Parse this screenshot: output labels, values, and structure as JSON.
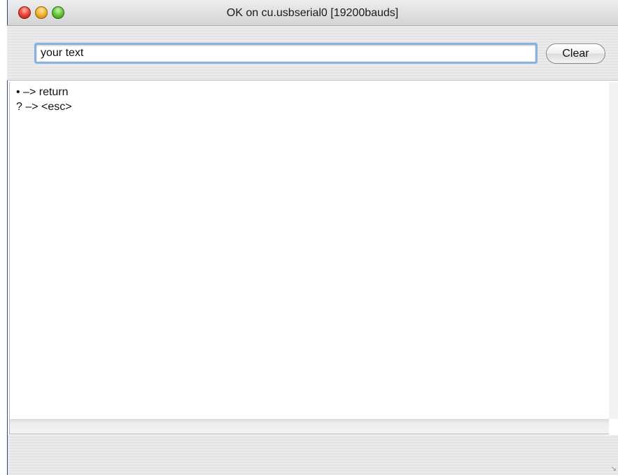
{
  "window": {
    "title": "OK on cu.usbserial0 [19200bauds]"
  },
  "toolbar": {
    "input_value": "your text",
    "clear_label": "Clear"
  },
  "output": {
    "lines": [
      "• –> return",
      "? –> <esc>"
    ]
  },
  "icons": {
    "close": "close-icon",
    "minimize": "minimize-icon",
    "zoom": "zoom-icon",
    "resize": "resize-grip-icon"
  },
  "colors": {
    "focus_ring": "#87b2e0",
    "close": "#ee4c40",
    "minimize": "#f5b93b",
    "zoom": "#6ccb3f"
  }
}
